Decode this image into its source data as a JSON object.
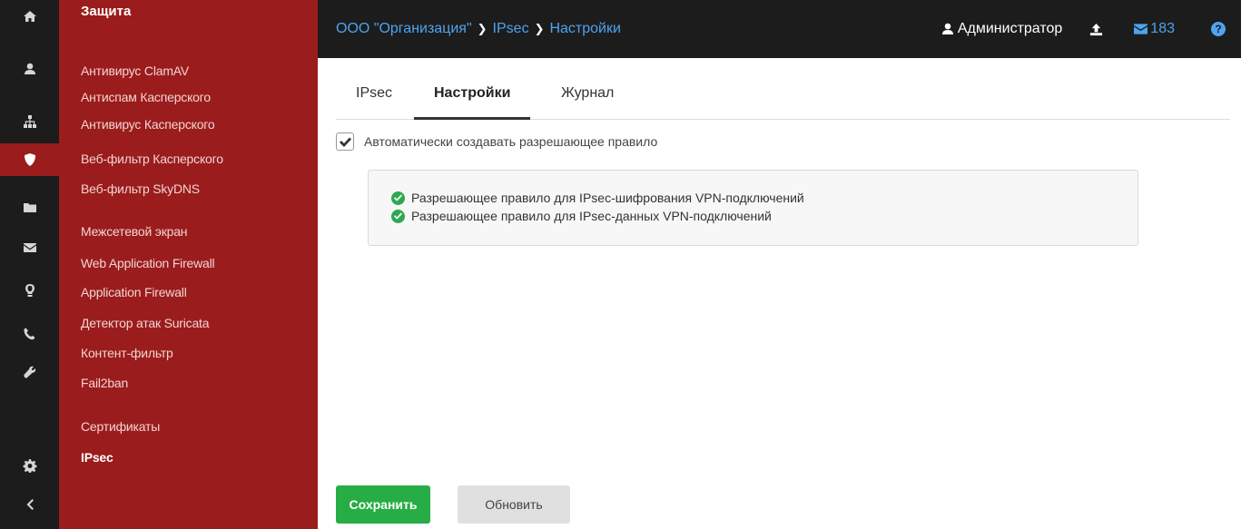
{
  "sidebar": {
    "icons": [
      "home-icon",
      "user-icon",
      "network-icon",
      "shield-icon",
      "folder-icon",
      "envelope-icon",
      "lightbulb-icon",
      "phone-icon",
      "wrench-icon",
      "gear-icon",
      "chevron-left-icon"
    ],
    "active_icon": "shield-icon"
  },
  "submenu": {
    "title": "Защита",
    "items": [
      "Антивирус ClamAV",
      "Антиспам Касперского",
      "Антивирус Касперского",
      "Веб-фильтр Касперского",
      "Веб-фильтр SkyDNS",
      "Межсетевой экран",
      "Web Application Firewall",
      "Application Firewall",
      "Детектор атак Suricata",
      "Контент-фильтр",
      "Fail2ban",
      "Сертификаты",
      "IPsec"
    ],
    "current": "IPsec"
  },
  "header": {
    "breadcrumb": [
      "ООО \"Организация\"",
      "IPsec",
      "Настройки"
    ],
    "user": "Администратор",
    "mail_count": "183",
    "help": "?"
  },
  "tabs": [
    {
      "label": "IPsec",
      "active": false
    },
    {
      "label": "Настройки",
      "active": true
    },
    {
      "label": "Журнал",
      "active": false
    }
  ],
  "settings": {
    "auto_rule_label": "Автоматически создавать разрешающее правило",
    "auto_rule_checked": true,
    "rules": [
      "Разрешающее правило для IPsec-шифрования VPN-подключений",
      "Разрешающее правило для IPsec-данных VPN-подключений"
    ]
  },
  "buttons": {
    "save": "Сохранить",
    "refresh": "Обновить"
  },
  "colors": {
    "sidebar_bg": "#1c1c1c",
    "submenu_bg": "#9b1c1c",
    "accent_link": "#4fa3ef",
    "save_green": "#27ad45",
    "ok_green": "#2fa84f"
  }
}
